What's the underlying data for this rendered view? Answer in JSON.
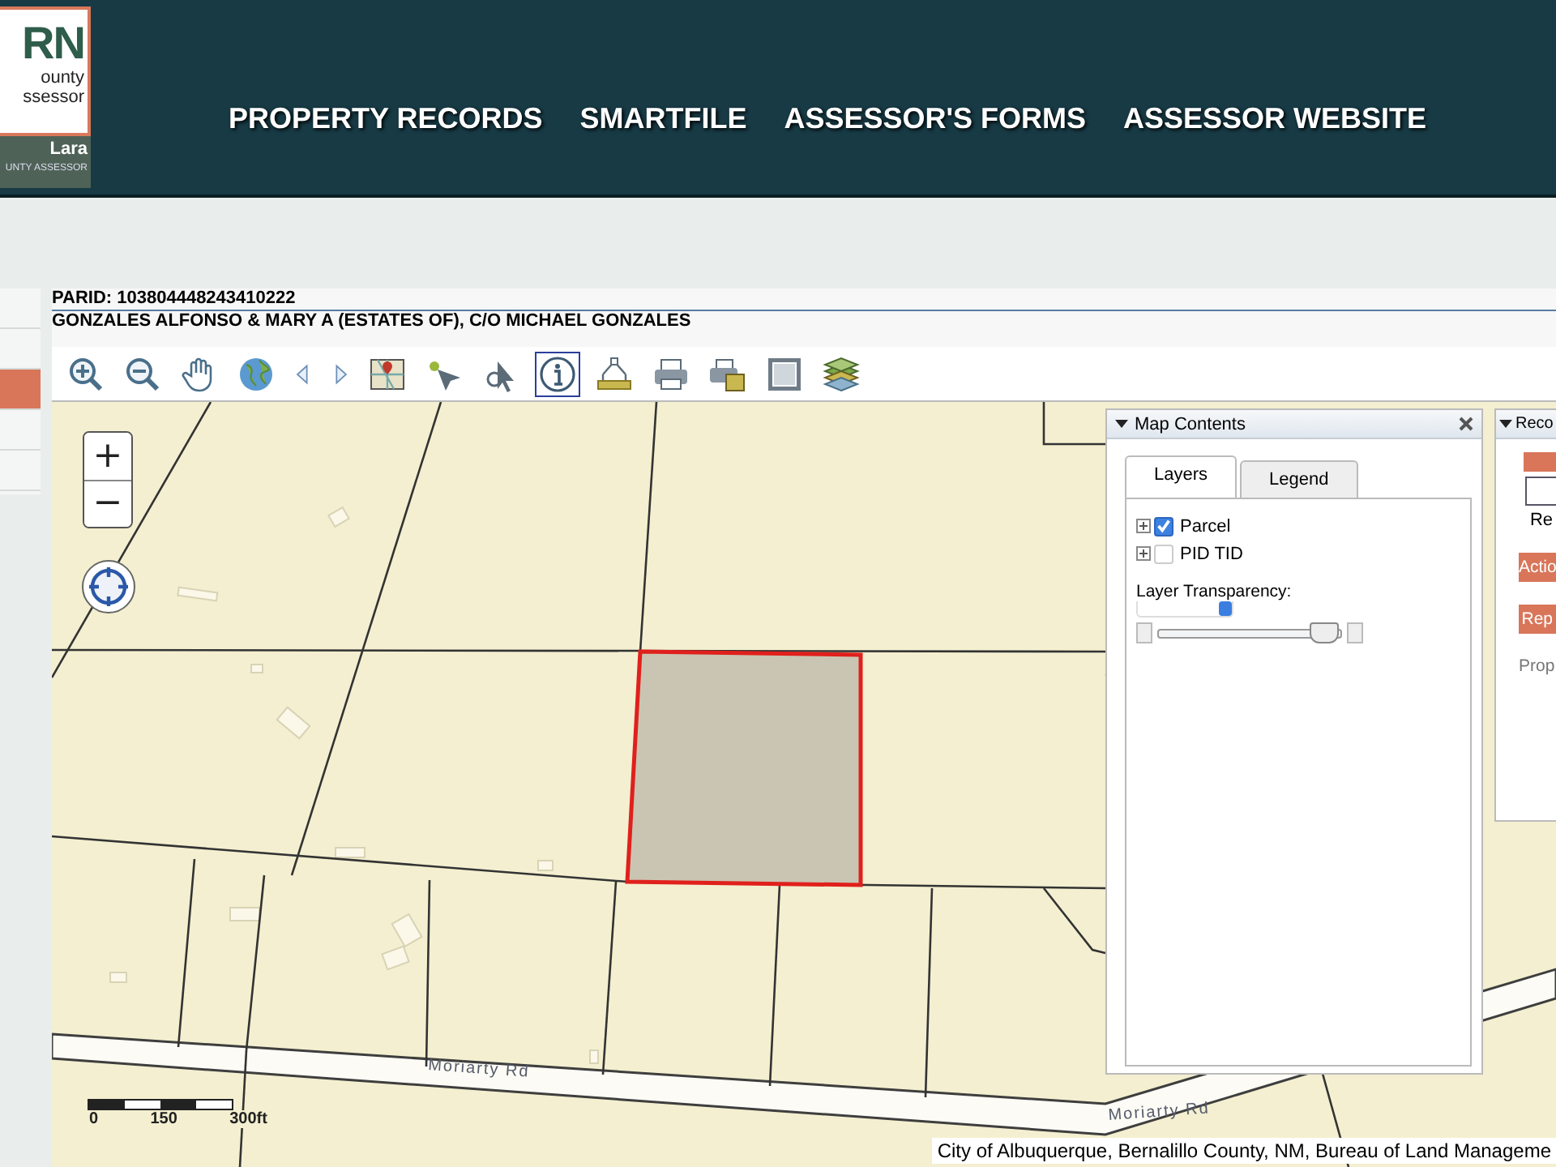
{
  "header": {
    "logo": {
      "mark": "RN",
      "line_1": "ounty",
      "line_2": "ssessor",
      "name": "Lara",
      "title": "UNTY ASSESSOR"
    },
    "nav": [
      "PROPERTY RECORDS",
      "SMARTFILE",
      "ASSESSOR'S FORMS",
      "ASSESSOR WEBSITE"
    ]
  },
  "sidebar": {
    "items": [
      {
        "selected": false
      },
      {
        "selected": false
      },
      {
        "selected": true
      },
      {
        "selected": false
      },
      {
        "selected": false
      }
    ]
  },
  "parcel": {
    "parid": "PARID: 103804448243410222",
    "owner": "GONZALES ALFONSO & MARY A (ESTATES OF), C/O MICHAEL GONZALES"
  },
  "toolbar": {
    "tools": [
      {
        "selected": false
      },
      {
        "selected": false
      },
      {
        "selected": false
      },
      {
        "selected": false
      },
      {
        "selected": false
      },
      {
        "selected": false
      },
      {
        "selected": false
      },
      {
        "selected": false
      },
      {
        "selected": false
      },
      {
        "selected": true
      },
      {
        "selected": false
      },
      {
        "selected": false
      },
      {
        "selected": false
      },
      {
        "selected": false
      },
      {
        "selected": false
      }
    ]
  },
  "map": {
    "zoom_in": "+",
    "zoom_out": "−",
    "scale_labels": [
      "0",
      "150",
      "300ft"
    ],
    "road_labels": [
      "Moriarty Rd",
      "Moriarty Rd"
    ],
    "attribution": "City of Albuquerque, Bernalillo County, NM, Bureau of Land Manageme"
  },
  "map_contents": {
    "title": "Map Contents",
    "tabs": [
      {
        "label": "Layers",
        "selected": true
      },
      {
        "label": "Legend",
        "selected": false
      }
    ],
    "layers": [
      {
        "name": "Parcel",
        "checked": true
      },
      {
        "name": "PID TID",
        "checked": false
      }
    ],
    "transparency_label": "Layer Transparency:",
    "transparency": {
      "level": 0.9
    }
  },
  "records_panel": {
    "title": "Reco",
    "field_label": "Re",
    "sections": [
      "Actio",
      "Rep"
    ],
    "text": "Prop"
  }
}
